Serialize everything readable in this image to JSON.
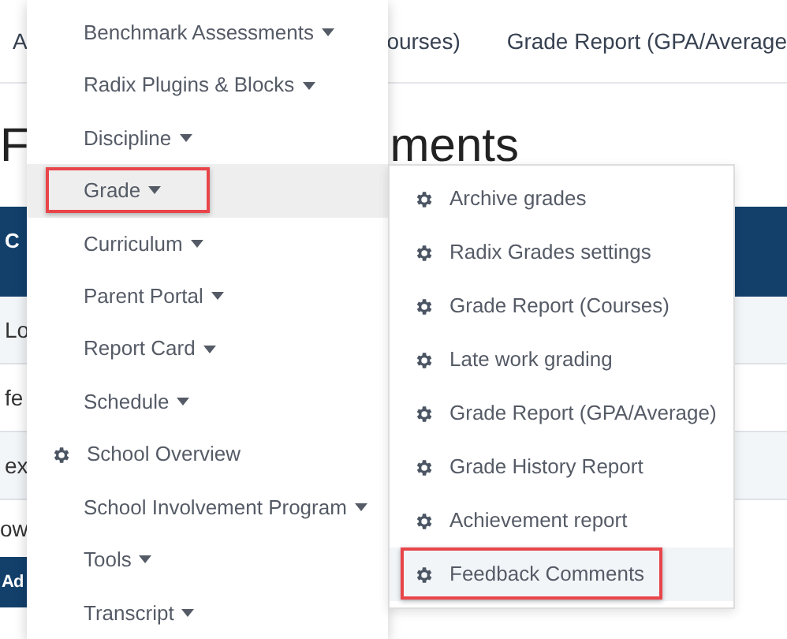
{
  "page": {
    "nav_items": [
      "A",
      "ourses)",
      "Grade Report (GPA/Average"
    ],
    "title_parts": [
      "F",
      "ments"
    ],
    "table": {
      "header": "C",
      "rows": [
        "Lo",
        "fe",
        "ex"
      ]
    },
    "text_below": "ow",
    "button": "Ad"
  },
  "menu": {
    "items": [
      {
        "label": "Benchmark Assessments",
        "kind": "submenu",
        "selected": false,
        "annotated": false
      },
      {
        "label": "Radix Plugins & Blocks",
        "kind": "submenu",
        "selected": false,
        "annotated": false
      },
      {
        "label": "Discipline",
        "kind": "submenu",
        "selected": false,
        "annotated": false
      },
      {
        "label": "Grade",
        "kind": "submenu",
        "selected": true,
        "annotated": true
      },
      {
        "label": "Curriculum",
        "kind": "submenu",
        "selected": false,
        "annotated": false
      },
      {
        "label": "Parent Portal",
        "kind": "submenu",
        "selected": false,
        "annotated": false
      },
      {
        "label": "Report Card",
        "kind": "submenu",
        "selected": false,
        "annotated": false
      },
      {
        "label": "Schedule",
        "kind": "submenu",
        "selected": false,
        "annotated": false
      },
      {
        "label": "School Overview",
        "kind": "link",
        "selected": false,
        "annotated": false
      },
      {
        "label": "School Involvement Program",
        "kind": "submenu",
        "selected": false,
        "annotated": false
      },
      {
        "label": "Tools",
        "kind": "submenu",
        "selected": false,
        "annotated": false
      },
      {
        "label": "Transcript",
        "kind": "submenu",
        "selected": false,
        "annotated": false
      }
    ]
  },
  "submenu": {
    "items": [
      {
        "label": "Archive grades",
        "selected": false,
        "annotated": false
      },
      {
        "label": "Radix Grades settings",
        "selected": false,
        "annotated": false
      },
      {
        "label": "Grade Report (Courses)",
        "selected": false,
        "annotated": false
      },
      {
        "label": "Late work grading",
        "selected": false,
        "annotated": false
      },
      {
        "label": "Grade Report (GPA/Average)",
        "selected": false,
        "annotated": false
      },
      {
        "label": "Grade History Report",
        "selected": false,
        "annotated": false
      },
      {
        "label": "Achievement report",
        "selected": false,
        "annotated": false
      },
      {
        "label": "Feedback Comments",
        "selected": true,
        "annotated": true
      }
    ]
  }
}
